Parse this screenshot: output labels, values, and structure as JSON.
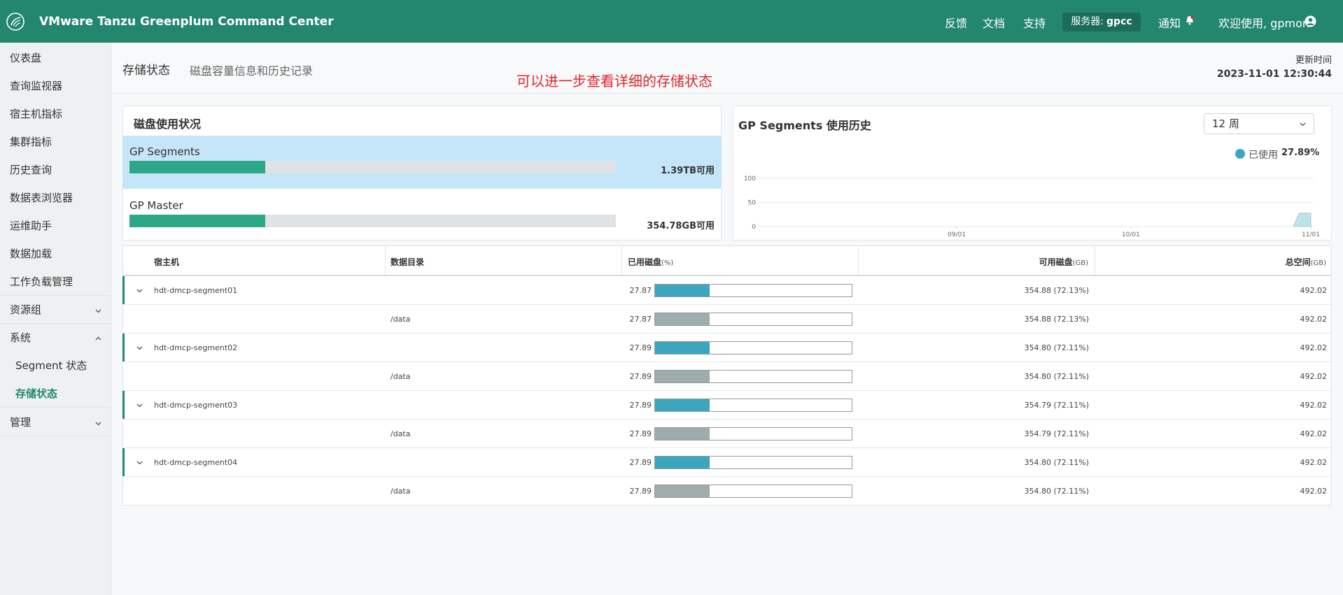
{
  "app": {
    "title": "VMware Tanzu Greenplum Command Center",
    "nav": [
      "反馈",
      "文档",
      "支持"
    ],
    "server_label": "服务器:",
    "server_name": "gpcc",
    "notifications": "通知",
    "welcome": "欢迎使用, gpmon",
    "accent_color": "#23876f"
  },
  "sidebar": {
    "items": [
      {
        "label": "仪表盘"
      },
      {
        "label": "查询监视器"
      },
      {
        "label": "宿主机指标"
      },
      {
        "label": "集群指标"
      },
      {
        "label": "历史查询"
      },
      {
        "label": "数据表浏览器"
      },
      {
        "label": "运维助手"
      },
      {
        "label": "数据加载"
      },
      {
        "label": "工作负载管理"
      },
      {
        "label": "资源组"
      },
      {
        "label": "系统"
      },
      {
        "label": "Segment 状态"
      },
      {
        "label": "存储状态"
      },
      {
        "label": "管理"
      }
    ]
  },
  "header": {
    "title": "存储状态",
    "subtitle": "磁盘容量信息和历史记录",
    "note": "可以进一步查看详细的存储状态",
    "update_label": "更新时间",
    "update_time": "2023-11-01 12:30:44"
  },
  "disk_usage": {
    "title": "磁盘使用状况",
    "rows": [
      {
        "name": "GP Segments",
        "available": "1.39TB可用",
        "used_fraction": 0.279
      },
      {
        "name": "GP Master",
        "available": "354.78GB可用",
        "used_fraction": 0.279
      }
    ]
  },
  "history": {
    "title": "GP Segments 使用历史",
    "range_select": "12 周",
    "legend_label": "已使用",
    "legend_value": "27.89%",
    "series_color": "#3ba6be"
  },
  "chart_data": {
    "type": "area",
    "title": "GP Segments 使用历史",
    "ylim": [
      0,
      100
    ],
    "y_ticks": [
      "0",
      "50",
      "100"
    ],
    "x_ticks": [
      "09/01",
      "10/01",
      "11/01"
    ],
    "series": [
      {
        "name": "已使用",
        "x": [
          "10/29",
          "10/30",
          "11/01"
        ],
        "values": [
          0,
          27.89,
          27.89
        ]
      }
    ],
    "grid": true,
    "legend": "top-right"
  },
  "table": {
    "headers": {
      "host": "宿主机",
      "dir": "数据目录",
      "used": "已用磁盘",
      "used_unit": "(%)",
      "avail": "可用磁盘",
      "avail_unit": "(GB)",
      "total": "总空间",
      "total_unit": "(GB)"
    },
    "rows": [
      {
        "host": "hdt-dmcp-segment01",
        "dir": "",
        "used": "27.87",
        "used_pct": 27.87,
        "avail": "354.88 (72.13%)",
        "total": "492.02",
        "kind": "host"
      },
      {
        "host": "",
        "dir": "/data",
        "used": "27.87",
        "used_pct": 27.87,
        "avail": "354.88 (72.13%)",
        "total": "492.02",
        "kind": "dir"
      },
      {
        "host": "hdt-dmcp-segment02",
        "dir": "",
        "used": "27.89",
        "used_pct": 27.89,
        "avail": "354.80 (72.11%)",
        "total": "492.02",
        "kind": "host"
      },
      {
        "host": "",
        "dir": "/data",
        "used": "27.89",
        "used_pct": 27.89,
        "avail": "354.80 (72.11%)",
        "total": "492.02",
        "kind": "dir"
      },
      {
        "host": "hdt-dmcp-segment03",
        "dir": "",
        "used": "27.89",
        "used_pct": 27.89,
        "avail": "354.79 (72.11%)",
        "total": "492.02",
        "kind": "host"
      },
      {
        "host": "",
        "dir": "/data",
        "used": "27.89",
        "used_pct": 27.89,
        "avail": "354.79 (72.11%)",
        "total": "492.02",
        "kind": "dir"
      },
      {
        "host": "hdt-dmcp-segment04",
        "dir": "",
        "used": "27.89",
        "used_pct": 27.89,
        "avail": "354.80 (72.11%)",
        "total": "492.02",
        "kind": "host"
      },
      {
        "host": "",
        "dir": "/data",
        "used": "27.89",
        "used_pct": 27.89,
        "avail": "354.80 (72.11%)",
        "total": "492.02",
        "kind": "dir"
      }
    ],
    "host_bar_color": "#3ba6be",
    "dir_bar_color": "#9eacad"
  }
}
